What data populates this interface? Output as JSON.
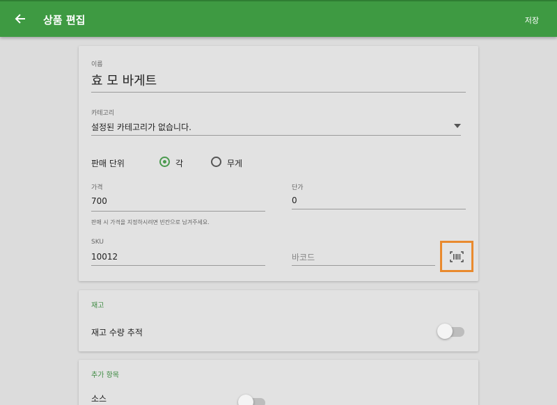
{
  "appbar": {
    "title": "상품 편집",
    "save_label": "저장",
    "color": "#3e9a42"
  },
  "product": {
    "name_label": "이름",
    "name_value": "효 모 바게트",
    "category_label": "카테고리",
    "category_value": "설정된 카테고리가 없습니다.",
    "sale_unit_label": "판매 단위",
    "unit_options": [
      {
        "label": "각",
        "selected": true
      },
      {
        "label": "무게",
        "selected": false
      }
    ],
    "price_label": "가격",
    "price_value": "700",
    "cost_label": "단가",
    "cost_value": "0",
    "price_hint": "판매 시 가격을 지정하시려면 빈칸으로 남겨주세요.",
    "sku_label": "SKU",
    "sku_value": "10012",
    "barcode_placeholder": "바코드",
    "barcode_icon": "barcode-scan-icon"
  },
  "inventory": {
    "section_title": "재고",
    "track_label": "재고 수량 추적",
    "track_enabled": false
  },
  "extras": {
    "section_title": "추가 항목",
    "sauce_label": "소스",
    "sauce_enabled": false
  },
  "accent_color": "#4a9a4e",
  "highlight_color": "#e98a2e"
}
